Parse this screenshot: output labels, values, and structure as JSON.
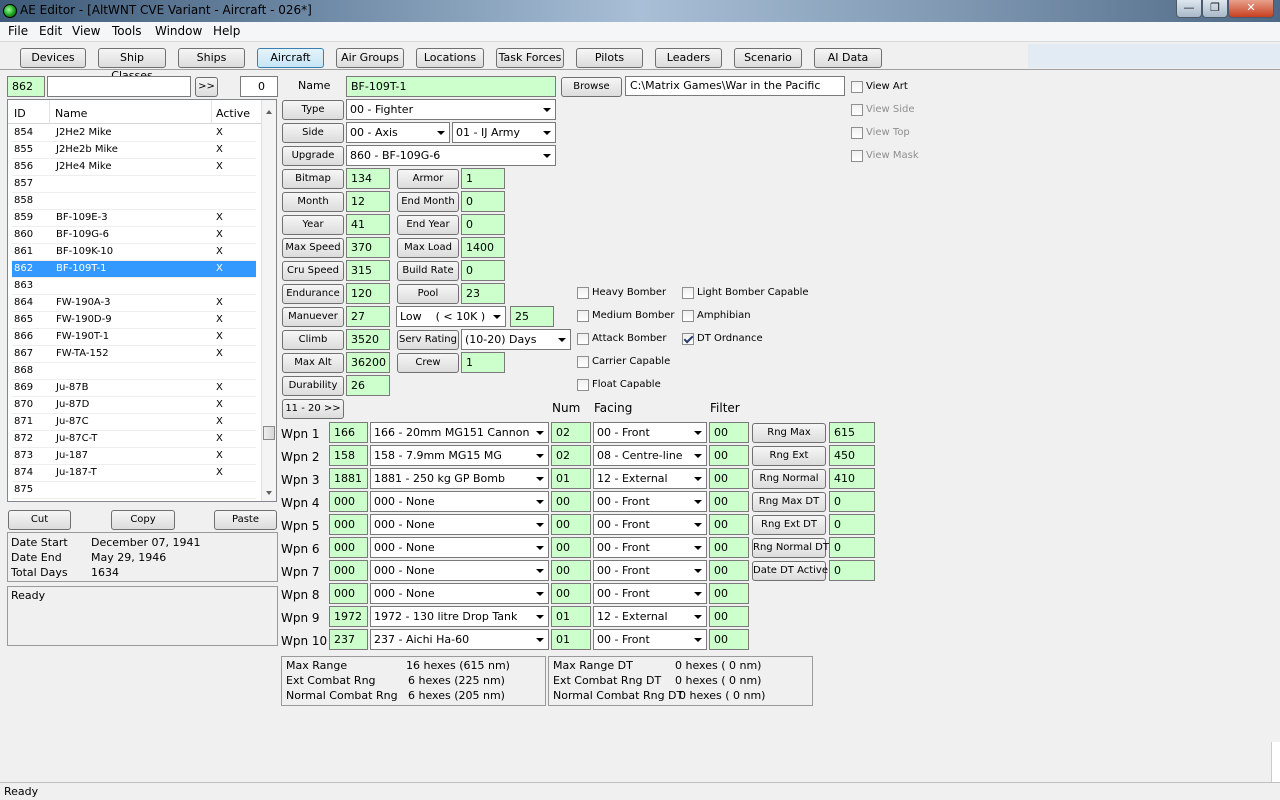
{
  "window": {
    "title": "AE Editor - [AltWNT CVE Variant - Aircraft - 026*]",
    "minimize": "—",
    "restore": "❐",
    "close": "✕"
  },
  "menu": [
    "File",
    "Edit",
    "View",
    "Tools",
    "Window",
    "Help"
  ],
  "tabs": [
    "Devices",
    "Ship Classes",
    "Ships",
    "Aircraft",
    "Air Groups",
    "Locations",
    "Task Forces",
    "Pilots",
    "Leaders",
    "Scenario",
    "AI Data"
  ],
  "active_tab": "Aircraft",
  "search": {
    "id_value": "862",
    "text_value": "",
    "go_label": ">>",
    "count": "0"
  },
  "list": {
    "columns": [
      "ID",
      "Name",
      "Active"
    ],
    "rows": [
      {
        "id": "854",
        "name": "J2He2 Mike",
        "active": "X"
      },
      {
        "id": "855",
        "name": "J2He2b Mike",
        "active": "X"
      },
      {
        "id": "856",
        "name": "J2He4 Mike",
        "active": "X"
      },
      {
        "id": "857",
        "name": "",
        "active": ""
      },
      {
        "id": "858",
        "name": "",
        "active": ""
      },
      {
        "id": "859",
        "name": "BF-109E-3",
        "active": "X"
      },
      {
        "id": "860",
        "name": "BF-109G-6",
        "active": "X"
      },
      {
        "id": "861",
        "name": "BF-109K-10",
        "active": "X"
      },
      {
        "id": "862",
        "name": "BF-109T-1",
        "active": "X"
      },
      {
        "id": "863",
        "name": "",
        "active": ""
      },
      {
        "id": "864",
        "name": "FW-190A-3",
        "active": "X"
      },
      {
        "id": "865",
        "name": "FW-190D-9",
        "active": "X"
      },
      {
        "id": "866",
        "name": "FW-190T-1",
        "active": "X"
      },
      {
        "id": "867",
        "name": "FW-TA-152",
        "active": "X"
      },
      {
        "id": "868",
        "name": "",
        "active": ""
      },
      {
        "id": "869",
        "name": "Ju-87B",
        "active": "X"
      },
      {
        "id": "870",
        "name": "Ju-87D",
        "active": "X"
      },
      {
        "id": "871",
        "name": "Ju-87C",
        "active": "X"
      },
      {
        "id": "872",
        "name": "Ju-87C-T",
        "active": "X"
      },
      {
        "id": "873",
        "name": "Ju-187",
        "active": "X"
      },
      {
        "id": "874",
        "name": "Ju-187-T",
        "active": "X"
      },
      {
        "id": "875",
        "name": "",
        "active": ""
      }
    ],
    "selected_id": "862"
  },
  "clipboard": {
    "cut": "Cut",
    "copy": "Copy",
    "paste": "Paste"
  },
  "dates": {
    "start_label": "Date Start",
    "start": "December 07, 1941",
    "end_label": "Date End",
    "end": "May 29, 1946",
    "total_label": "Total Days",
    "total": "1634"
  },
  "status_box": "Ready",
  "form": {
    "name_label": "Name",
    "name": "BF-109T-1",
    "browse": "Browse",
    "path": "C:\\Matrix Games\\War in the Pacific",
    "type_btn": "Type",
    "type": "00 - Fighter",
    "side_btn": "Side",
    "side": "00 - Axis",
    "nation": "01 - IJ Army",
    "upgrade_btn": "Upgrade",
    "upgrade": "860 - BF-109G-6",
    "bitmap_btn": "Bitmap",
    "bitmap": "134",
    "armor_btn": "Armor",
    "armor": "1",
    "month_btn": "Month",
    "month": "12",
    "end_month_btn": "End Month",
    "end_month": "0",
    "year_btn": "Year",
    "year": "41",
    "end_year_btn": "End Year",
    "end_year": "0",
    "max_speed_btn": "Max Speed",
    "max_speed": "370",
    "max_load_btn": "Max Load",
    "max_load": "1400",
    "cru_speed_btn": "Cru Speed",
    "cru_speed": "315",
    "build_rate_btn": "Build Rate",
    "build_rate": "0",
    "endurance_btn": "Endurance",
    "endurance": "120",
    "pool_btn": "Pool",
    "pool": "23",
    "manuever_btn": "Manuever",
    "manuever": "27",
    "alt_band": "Low    ( < 10K )",
    "alt_band_val": "25",
    "climb_btn": "Climb",
    "climb": "3520",
    "serv_rating_btn": "Serv Rating",
    "serv_rating": "(10-20) Days",
    "max_alt_btn": "Max Alt",
    "max_alt": "36200",
    "crew_btn": "Crew",
    "crew": "1",
    "durability_btn": "Durability",
    "durability": "26",
    "next_btn": "11 - 20 >>"
  },
  "view_checks": [
    {
      "label": "View Art",
      "checked": false,
      "enabled": true
    },
    {
      "label": "View Side",
      "checked": false,
      "enabled": false
    },
    {
      "label": "View Top",
      "checked": false,
      "enabled": false
    },
    {
      "label": "View Mask",
      "checked": false,
      "enabled": false
    }
  ],
  "capabilities": [
    {
      "label": "Heavy Bomber",
      "checked": false
    },
    {
      "label": "Medium Bomber",
      "checked": false
    },
    {
      "label": "Attack Bomber",
      "checked": false
    },
    {
      "label": "Carrier Capable",
      "checked": false
    },
    {
      "label": "Float Capable",
      "checked": false
    },
    {
      "label": "Light Bomber Capable",
      "checked": false
    },
    {
      "label": "Amphibian",
      "checked": false
    },
    {
      "label": "DT Ordnance",
      "checked": true
    }
  ],
  "weapons_header": {
    "num": "Num",
    "facing": "Facing",
    "filter": "Filter"
  },
  "weapons": [
    {
      "label": "Wpn 1",
      "id": "166",
      "device": "166 - 20mm MG151 Cannon",
      "num": "02",
      "facing": "00 - Front",
      "filter": "00"
    },
    {
      "label": "Wpn 2",
      "id": "158",
      "device": "158 - 7.9mm MG15 MG",
      "num": "02",
      "facing": "08 - Centre-line",
      "filter": "00"
    },
    {
      "label": "Wpn 3",
      "id": "1881",
      "device": "1881 - 250 kg GP Bomb",
      "num": "01",
      "facing": "12 - External",
      "filter": "00"
    },
    {
      "label": "Wpn 4",
      "id": "000",
      "device": "000 - None",
      "num": "00",
      "facing": "00 - Front",
      "filter": "00"
    },
    {
      "label": "Wpn 5",
      "id": "000",
      "device": "000 - None",
      "num": "00",
      "facing": "00 - Front",
      "filter": "00"
    },
    {
      "label": "Wpn 6",
      "id": "000",
      "device": "000 - None",
      "num": "00",
      "facing": "00 - Front",
      "filter": "00"
    },
    {
      "label": "Wpn 7",
      "id": "000",
      "device": "000 - None",
      "num": "00",
      "facing": "00 - Front",
      "filter": "00"
    },
    {
      "label": "Wpn 8",
      "id": "000",
      "device": "000 - None",
      "num": "00",
      "facing": "00 - Front",
      "filter": "00"
    },
    {
      "label": "Wpn 9",
      "id": "1972",
      "device": "1972 - 130 litre Drop Tank",
      "num": "01",
      "facing": "12 - External",
      "filter": "00"
    },
    {
      "label": "Wpn 10",
      "id": "237",
      "device": "237 - Aichi Ha-60",
      "num": "01",
      "facing": "00 - Front",
      "filter": "00"
    }
  ],
  "ranges": [
    {
      "btn": "Rng Max",
      "value": "615"
    },
    {
      "btn": "Rng Ext",
      "value": "450"
    },
    {
      "btn": "Rng Normal",
      "value": "410"
    },
    {
      "btn": "Rng Max DT",
      "value": "0"
    },
    {
      "btn": "Rng Ext DT",
      "value": "0"
    },
    {
      "btn": "Rng Normal DT",
      "value": "0"
    },
    {
      "btn": "Date DT Active",
      "value": "0"
    }
  ],
  "range_summary": {
    "left": [
      {
        "label": "Max Range",
        "value": "16 hexes (615 nm)"
      },
      {
        "label": "Ext Combat Rng",
        "value": "6 hexes (225 nm)"
      },
      {
        "label": "Normal Combat Rng",
        "value": "6 hexes (205 nm)"
      }
    ],
    "right": [
      {
        "label": "Max Range DT",
        "value": "0 hexes ( 0 nm)"
      },
      {
        "label": "Ext Combat Rng DT",
        "value": "0 hexes ( 0 nm)"
      },
      {
        "label": "Normal Combat Rng DT",
        "value": "0 hexes ( 0 nm)"
      }
    ]
  },
  "statusbar": "Ready"
}
